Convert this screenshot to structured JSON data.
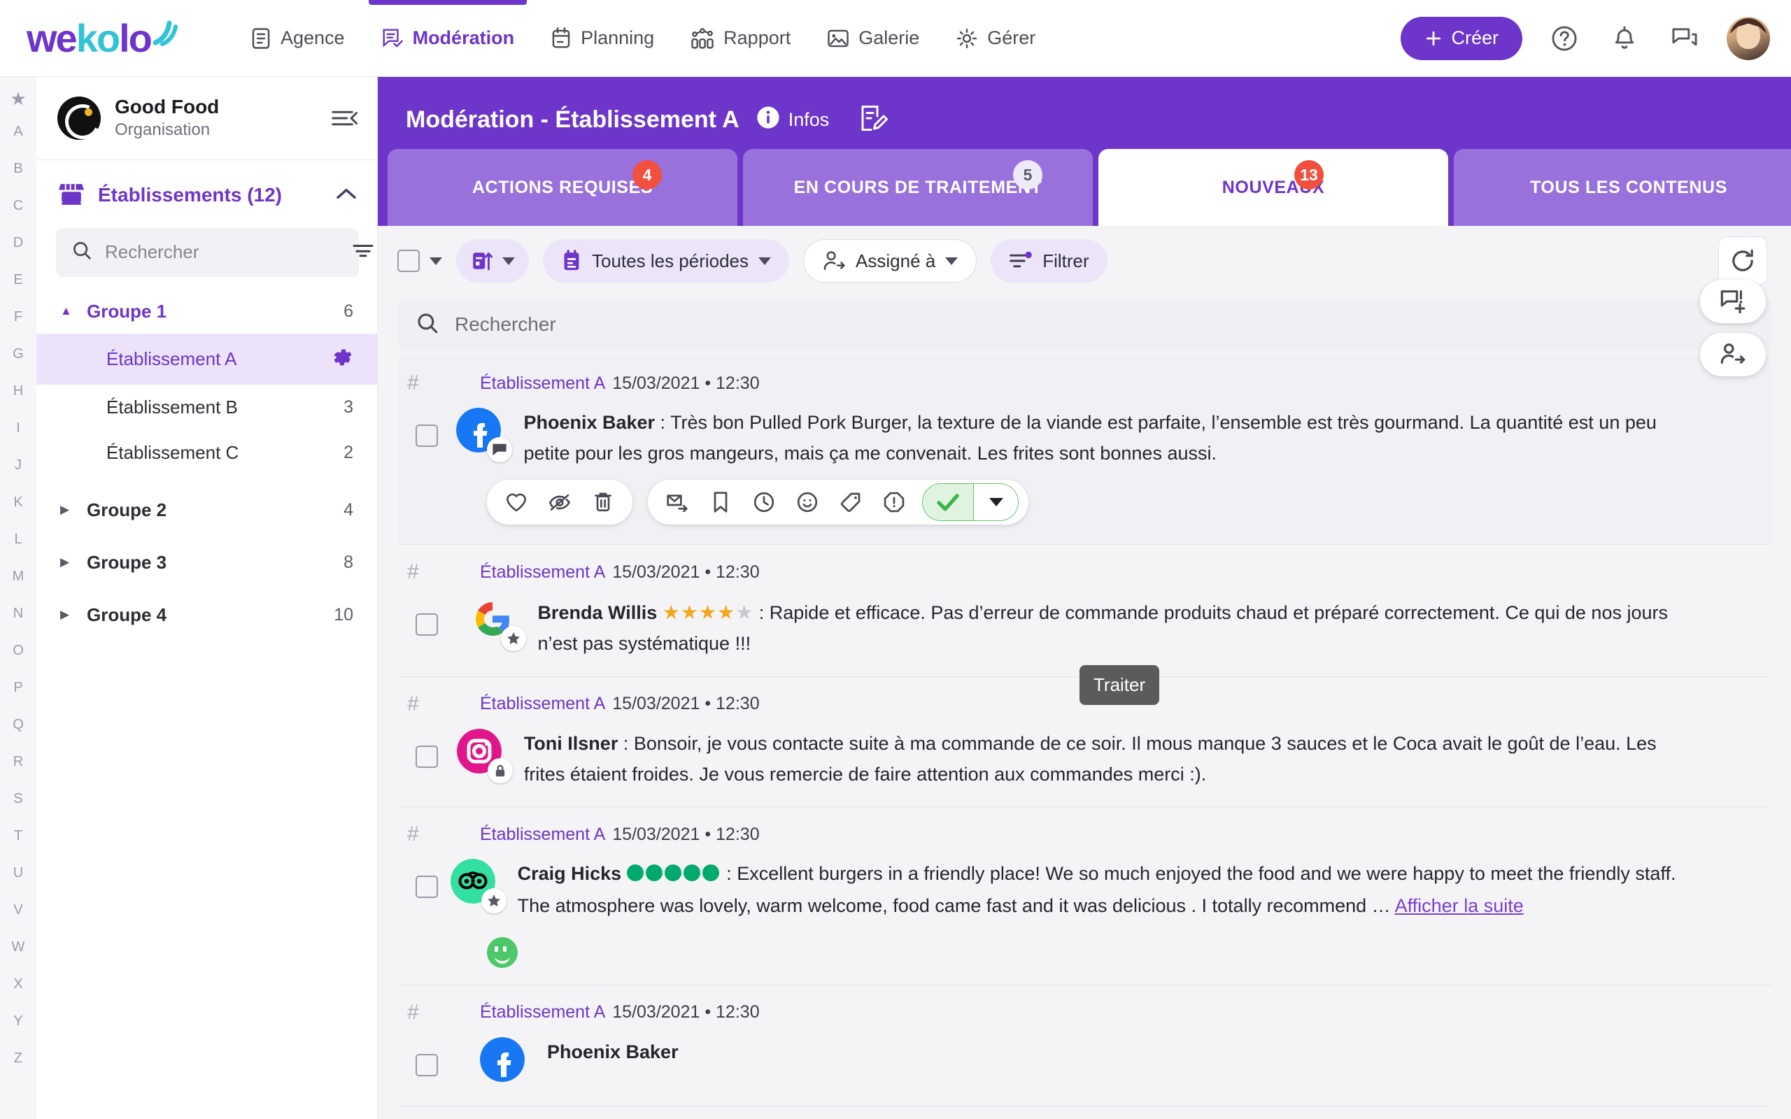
{
  "topnav": {
    "logo": {
      "part1": "we",
      "part2": "ko",
      "part3": "lo",
      "icon": "wifi-arcs-icon"
    },
    "items": [
      {
        "label": "Agence",
        "icon": "document-icon",
        "active": false
      },
      {
        "label": "Modération",
        "icon": "comment-check-icon",
        "active": true
      },
      {
        "label": "Planning",
        "icon": "calendar-icon",
        "active": false
      },
      {
        "label": "Rapport",
        "icon": "bar-chart-icon",
        "active": false
      },
      {
        "label": "Galerie",
        "icon": "image-icon",
        "active": false
      },
      {
        "label": "Gérer",
        "icon": "gear-icon",
        "active": false
      }
    ],
    "create_button": "Créer",
    "icons": [
      "help-circle-icon",
      "bell-icon",
      "chat-icon",
      "avatar"
    ],
    "accent_color": "#6d35c9"
  },
  "alpha_rail": {
    "star": "★",
    "letters": [
      "A",
      "B",
      "C",
      "D",
      "E",
      "F",
      "G",
      "H",
      "I",
      "J",
      "K",
      "L",
      "M",
      "N",
      "O",
      "P",
      "Q",
      "R",
      "S",
      "T",
      "U",
      "V",
      "W",
      "X",
      "Y",
      "Z"
    ]
  },
  "sidebar": {
    "org": {
      "name": "Good Food",
      "subtitle": "Organisation",
      "logo": "good-food-logo"
    },
    "collapse_icon": "collapse-sidebar-icon",
    "section": {
      "title": "Établissements (12)",
      "icon": "storefront-icon",
      "chevron": "chevron-up-icon"
    },
    "search": {
      "placeholder": "Rechercher",
      "value": "",
      "icon": "search-icon",
      "filter_icon": "filter-icon"
    },
    "tree": [
      {
        "type": "group",
        "label": "Groupe 1",
        "count": "6",
        "open": true
      },
      {
        "type": "item",
        "label": "Établissement A",
        "count": "",
        "selected": true,
        "gear": "gear-icon"
      },
      {
        "type": "item",
        "label": "Établissement B",
        "count": "3",
        "selected": false
      },
      {
        "type": "item",
        "label": "Établissement C",
        "count": "2",
        "selected": false
      },
      {
        "type": "group",
        "label": "Groupe 2",
        "count": "4",
        "open": false
      },
      {
        "type": "group",
        "label": "Groupe 3",
        "count": "8",
        "open": false
      },
      {
        "type": "group",
        "label": "Groupe 4",
        "count": "10",
        "open": false
      }
    ]
  },
  "header": {
    "title": "Modération - Établissement A",
    "infos_label": "Infos",
    "infos_icon": "info-icon",
    "edit_icon": "note-edit-icon"
  },
  "tabs": [
    {
      "label": "ACTIONS REQUISES",
      "badge": "4",
      "badge_style": "red",
      "active": false
    },
    {
      "label": "EN COURS DE TRAITEMENT",
      "badge": "5",
      "badge_style": "light",
      "active": false
    },
    {
      "label": "NOUVEAUX",
      "badge": "13",
      "badge_style": "red",
      "active": true
    },
    {
      "label": "TOUS LES CONTENUS",
      "badge": "",
      "badge_style": "",
      "active": false
    }
  ],
  "toolbar": {
    "select_all_checkbox": "",
    "sort_button": "sort-date-icon",
    "period_filter": "Toutes les périodes",
    "assigned_filter": "Assigné à",
    "filter_button": "Filtrer",
    "refresh_button": "refresh-icon"
  },
  "search": {
    "placeholder": "Rechercher",
    "value": "",
    "icon": "search-icon"
  },
  "tooltip": {
    "text": "Traiter"
  },
  "float_buttons": [
    {
      "icon": "add-comment-icon"
    },
    {
      "icon": "assign-user-icon"
    }
  ],
  "actions": {
    "group1": [
      "heart-icon",
      "eye-off-icon",
      "trash-icon"
    ],
    "group2": [
      "mail-forward-icon",
      "bookmark-icon",
      "clock-icon",
      "smiley-icon",
      "tag-icon",
      "alert-octagon-icon"
    ],
    "confirm": "check-icon",
    "confirm_dropdown": "chevron-down-icon"
  },
  "reviews": [
    {
      "hash": "#",
      "establishment": "Établissement A",
      "meta": "15/03/2021 • 12:30",
      "network": "facebook",
      "network_badge": "comment-icon",
      "author": "Phoenix Baker",
      "rating": null,
      "text": " : Très bon Pulled Pork Burger, la texture de la viande est parfaite, l’ensemble est très gourmand. La quantité est un peu petite pour les gros mangeurs, mais ça me convenait. Les frites sont bonnes aussi.",
      "highlight": true,
      "show_actions": true,
      "sentiment": null,
      "more_link": ""
    },
    {
      "hash": "#",
      "establishment": "Établissement A",
      "meta": "15/03/2021 • 12:30",
      "network": "google",
      "network_badge": "star-icon",
      "author": "Brenda Willis",
      "rating": {
        "type": "stars",
        "filled": 4,
        "total": 5
      },
      "text": " : Rapide et efficace. Pas d’erreur de commande produits chaud et préparé correctement. Ce qui de nos jours n’est pas systématique !!!",
      "highlight": false,
      "show_actions": false,
      "sentiment": null,
      "more_link": ""
    },
    {
      "hash": "#",
      "establishment": "Établissement A",
      "meta": "15/03/2021 • 12:30",
      "network": "instagram",
      "network_badge": "lock-icon",
      "author": "Toni Ilsner",
      "rating": null,
      "text": " : Bonsoir, je vous contacte suite à ma commande de ce soir. Il mous manque 3 sauces et le Coca avait le goût de l’eau. Les frites étaient froides. Je vous remercie de faire attention aux commandes merci :).",
      "highlight": false,
      "show_actions": false,
      "sentiment": null,
      "more_link": ""
    },
    {
      "hash": "#",
      "establishment": "Établissement A",
      "meta": "15/03/2021 • 12:30",
      "network": "tripadvisor",
      "network_badge": "star-icon",
      "author": "Craig Hicks",
      "rating": {
        "type": "dots",
        "filled": 5,
        "total": 5
      },
      "text": " : Excellent burgers in a friendly place! We so much enjoyed the food and we were happy to meet the friendly staff. The atmosphere was lovely, warm welcome, food came fast and it was delicious . I totally recommend … ",
      "highlight": false,
      "show_actions": false,
      "sentiment": "positive-smiley",
      "more_link": "Afficher la suite"
    },
    {
      "hash": "#",
      "establishment": "Établissement A",
      "meta": "15/03/2021 • 12:30",
      "network": "facebook",
      "network_badge": "comment-icon",
      "author": "Phoenix Baker",
      "rating": null,
      "text": " : ...",
      "highlight": false,
      "show_actions": false,
      "sentiment": null,
      "more_link": ""
    }
  ]
}
